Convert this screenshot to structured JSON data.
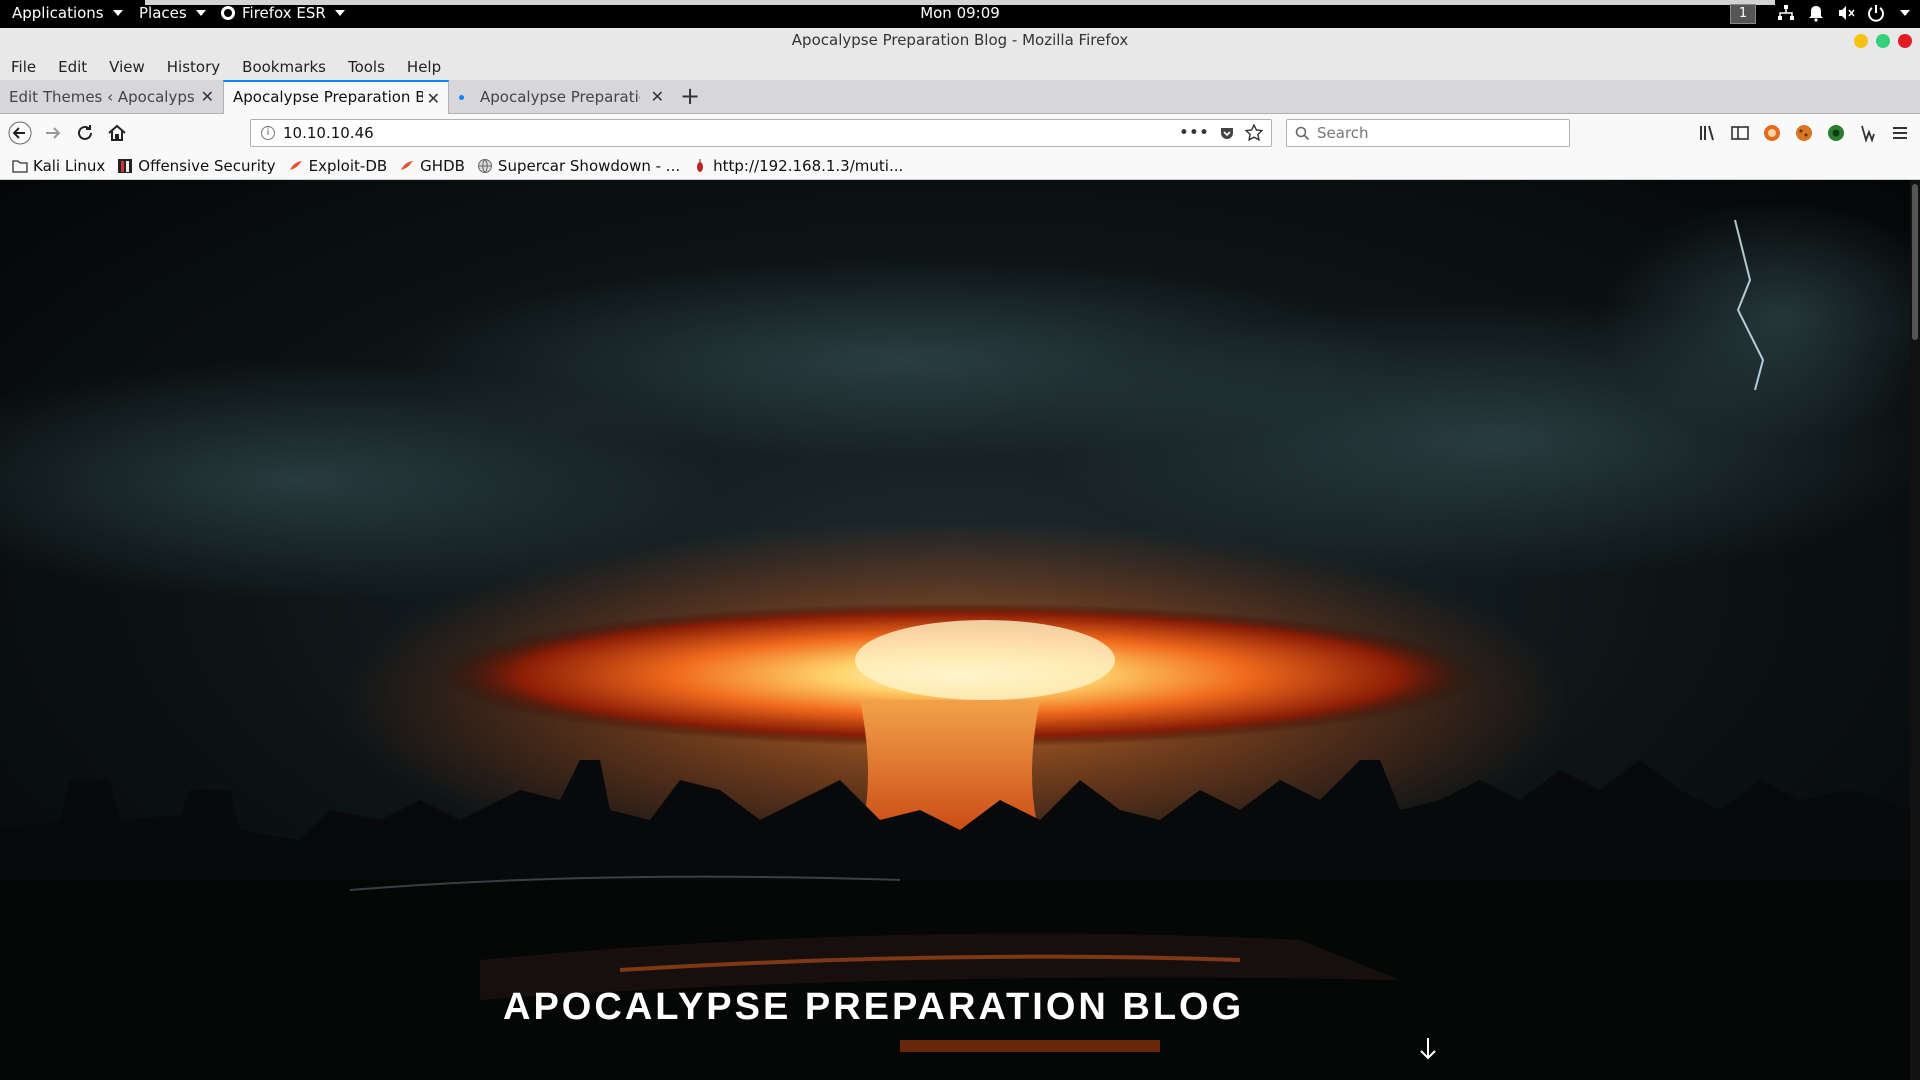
{
  "topbar": {
    "applications": "Applications",
    "places": "Places",
    "app_name": "Firefox ESR",
    "clock": "Mon 09:09",
    "workspace": "1"
  },
  "window": {
    "title": "Apocalypse Preparation Blog - Mozilla Firefox"
  },
  "menubar": [
    "File",
    "Edit",
    "View",
    "History",
    "Bookmarks",
    "Tools",
    "Help"
  ],
  "tabs": [
    {
      "title": "Edit Themes ‹ Apocalypse Pr",
      "active": false
    },
    {
      "title": "Apocalypse Preparation Blo",
      "active": true
    },
    {
      "title": "Apocalypse Preparation I",
      "active": false
    }
  ],
  "navbar": {
    "url": "10.10.10.46",
    "search_placeholder": "Search"
  },
  "bookmarks": [
    {
      "label": "Kali Linux",
      "icon": "folder-icon"
    },
    {
      "label": "Offensive Security",
      "icon": "offsec-icon"
    },
    {
      "label": "Exploit-DB",
      "icon": "exploitdb-icon"
    },
    {
      "label": "GHDB",
      "icon": "ghdb-icon"
    },
    {
      "label": "Supercar Showdown - ...",
      "icon": "globe-icon"
    },
    {
      "label": "http://192.168.1.3/muti...",
      "icon": "bug-icon"
    }
  ],
  "page": {
    "hero_title": "APOCALYPSE PREPARATION BLOG"
  },
  "colors": {
    "accent": "#0a84ff",
    "chrome_bg": "#f9f9fa",
    "tab_strip": "#d7d7db"
  }
}
